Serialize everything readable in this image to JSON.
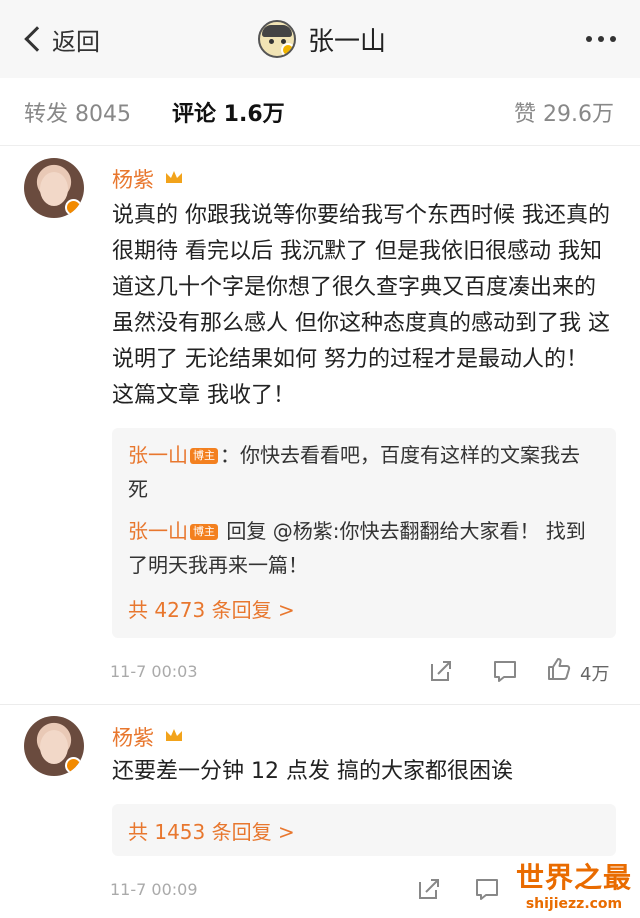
{
  "header": {
    "back_label": "返回",
    "title": "张一山"
  },
  "tabs": {
    "repost": "转发 8045",
    "comment": "评论 1.6万",
    "like": "赞 29.6万"
  },
  "comments": [
    {
      "user": "杨紫",
      "text": "说真的 你跟我说等你要给我写个东西时候 我还真的很期待 看完以后 我沉默了 但是我依旧很感动 我知道这几十个字是你想了很久查字典又百度凑出来的 虽然没有那么感人 但你这种态度真的感动到了我 这说明了 无论结果如何 努力的过程才是最动人的！ 这篇文章 我收了！",
      "replies": [
        {
          "name": "张一山",
          "tag": "博主",
          "text": "：你快去看看吧，百度有这样的文案我去死"
        },
        {
          "name": "张一山",
          "tag": "博主",
          "text": " 回复 @杨紫:你快去翻翻给大家看！ 找到了明天我再来一篇！"
        }
      ],
      "more_replies": "共 4273 条回复 >",
      "time": "11-7 00:03",
      "likes": "4万"
    },
    {
      "user": "杨紫",
      "text": "还要差一分钟 12 点发 搞的大家都很困诶",
      "replies": [],
      "more_replies": "共 1453 条回复 >",
      "time": "11-7 00:09"
    }
  ],
  "watermark": {
    "title": "世界之最",
    "url": "shijiezz.com"
  },
  "colors": {
    "accent": "#e8772e",
    "text": "#222222",
    "muted": "#aaaaaa"
  }
}
